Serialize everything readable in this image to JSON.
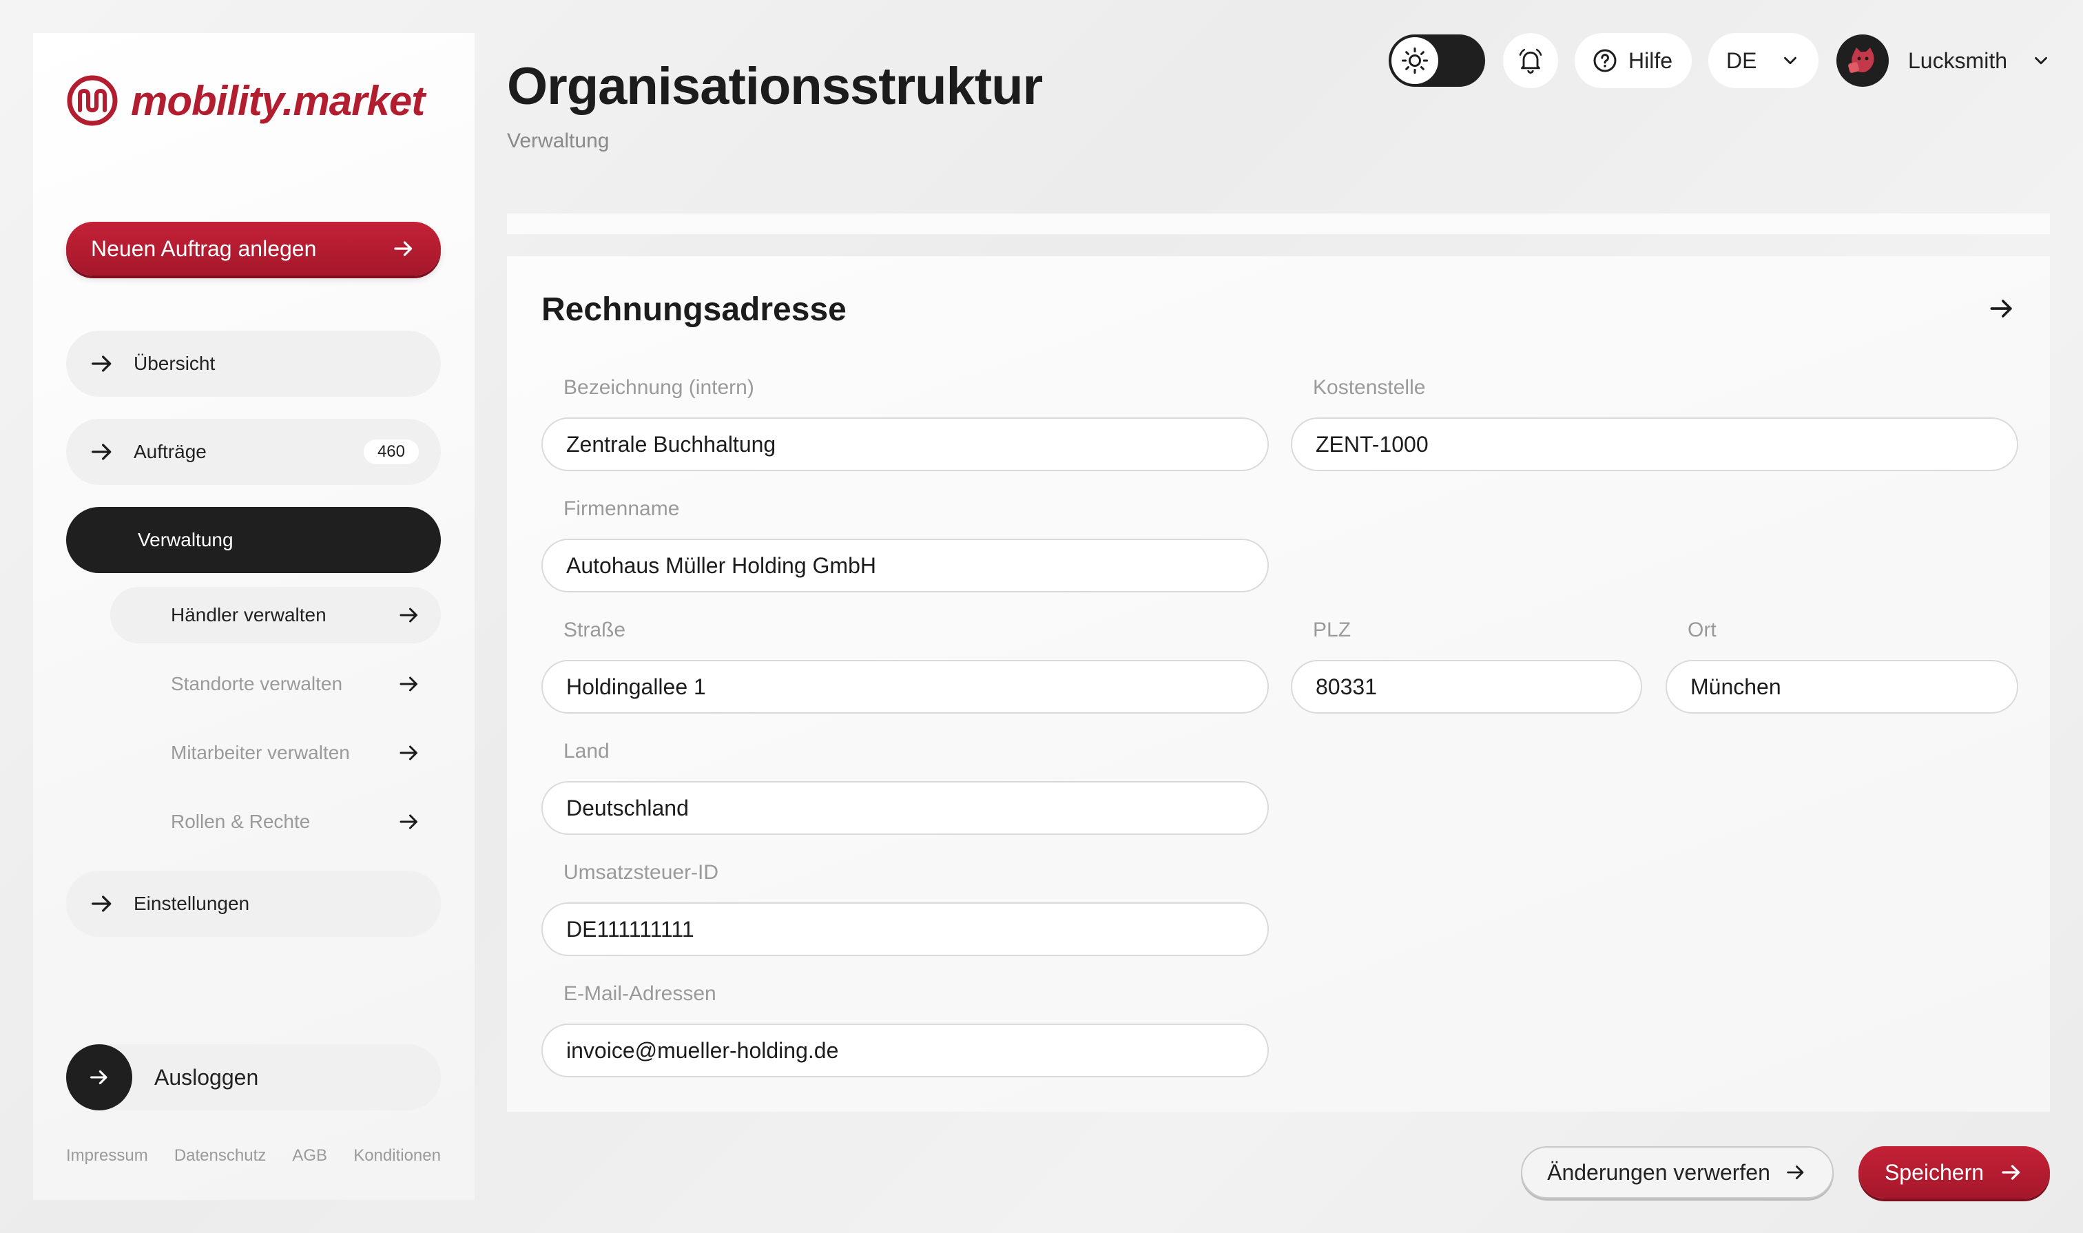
{
  "brand": {
    "name": "mobility.market",
    "accent": "#b21d2f"
  },
  "sidebar": {
    "new_order_label": "Neuen Auftrag anlegen",
    "nav": [
      {
        "label": "Übersicht",
        "icon": "arrow-right-icon"
      },
      {
        "label": "Aufträge",
        "icon": "arrow-right-icon",
        "badge": "460"
      },
      {
        "label": "Verwaltung",
        "active": true
      },
      {
        "label": "Einstellungen",
        "icon": "arrow-right-icon"
      }
    ],
    "sub_nav": [
      {
        "label": "Händler verwalten",
        "active": true
      },
      {
        "label": "Standorte verwalten"
      },
      {
        "label": "Mitarbeiter verwalten"
      },
      {
        "label": "Rollen & Rechte"
      }
    ],
    "logout_label": "Ausloggen",
    "footer_links": [
      "Impressum",
      "Datenschutz",
      "AGB",
      "Konditionen"
    ]
  },
  "header": {
    "title": "Organisationsstruktur",
    "subtitle": "Verwaltung",
    "theme_icon": "sun-icon",
    "bell_icon": "bell-icon",
    "help_label": "Hilfe",
    "language": "DE",
    "user_name": "Lucksmith"
  },
  "form": {
    "title": "Rechnungsadresse",
    "fields": {
      "bezeichnung": {
        "label": "Bezeichnung (intern)",
        "value": "Zentrale Buchhaltung"
      },
      "kostenstelle": {
        "label": "Kostenstelle",
        "value": "ZENT-1000"
      },
      "firmenname": {
        "label": "Firmenname",
        "value": "Autohaus Müller Holding GmbH"
      },
      "strasse": {
        "label": "Straße",
        "value": "Holdingallee 1"
      },
      "plz": {
        "label": "PLZ",
        "value": "80331"
      },
      "ort": {
        "label": "Ort",
        "value": "München"
      },
      "land": {
        "label": "Land",
        "value": "Deutschland"
      },
      "ustid": {
        "label": "Umsatzsteuer-ID",
        "value": "DE111111111"
      },
      "email": {
        "label": "E-Mail-Adressen",
        "value": "invoice@mueller-holding.de"
      }
    }
  },
  "actions": {
    "discard_label": "Änderungen verwerfen",
    "save_label": "Speichern"
  }
}
